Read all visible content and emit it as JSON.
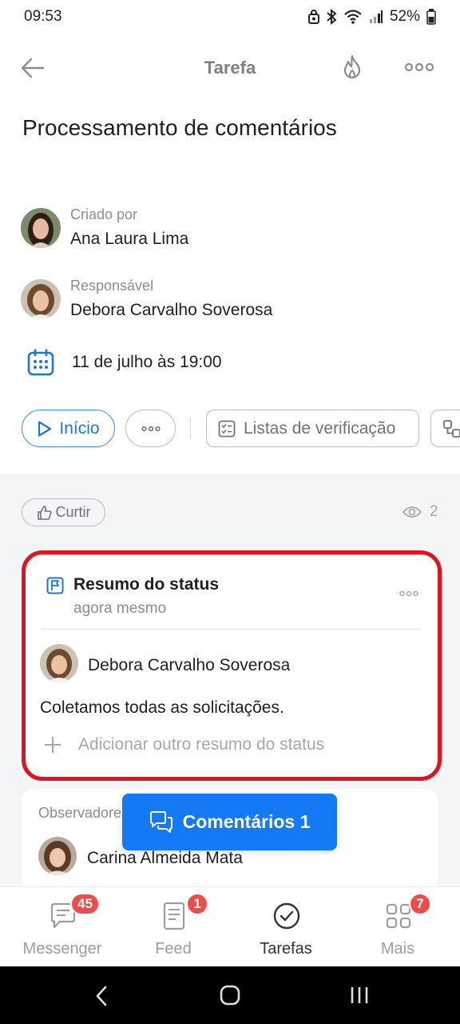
{
  "status_bar": {
    "time": "09:53",
    "battery": "52%"
  },
  "header": {
    "title": "Tarefa"
  },
  "task": {
    "title": "Processamento de comentários"
  },
  "created_by": {
    "label": "Criado por",
    "name": "Ana Laura Lima"
  },
  "responsible": {
    "label": "Responsável",
    "name": "Debora Carvalho Soverosa"
  },
  "deadline": {
    "text": "11 de julho às 19:00"
  },
  "actions": {
    "start_label": "Início",
    "checklists_label": "Listas de verificação"
  },
  "like": {
    "label": "Curtir"
  },
  "views": {
    "count": "2"
  },
  "status_summary": {
    "title": "Resumo do status",
    "time": "agora mesmo",
    "author": "Debora Carvalho Soverosa",
    "text": "Coletamos todas as solicitações.",
    "add_label": "Adicionar outro resumo do status"
  },
  "observers": {
    "label": "Observadores",
    "name": "Carina Almeida Mata"
  },
  "comments_button": {
    "label": "Comentários 1"
  },
  "bottom_nav": {
    "items": [
      {
        "label": "Messenger",
        "badge": "45"
      },
      {
        "label": "Feed",
        "badge": "1"
      },
      {
        "label": "Tarefas",
        "badge": ""
      },
      {
        "label": "Mais",
        "badge": "7"
      }
    ]
  },
  "colors": {
    "accent": "#1479f5",
    "highlight_border": "#e0141c",
    "badge": "#f04b4b"
  }
}
